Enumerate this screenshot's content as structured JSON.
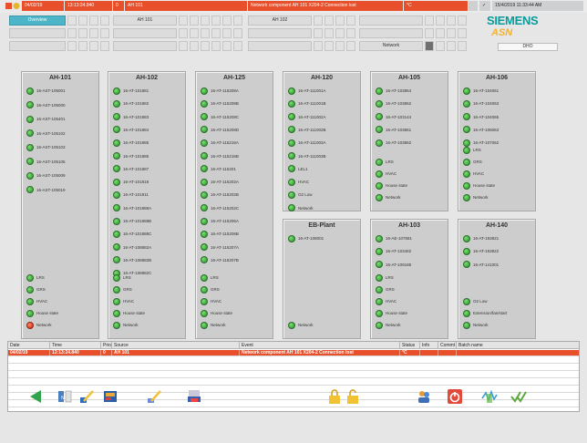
{
  "top_bar": {
    "date": "04/02/19",
    "time": "13:13:24.840",
    "flag": "0",
    "source": "AH 101",
    "message": "Network component AH 101 X204-2 Connection lost",
    "status": "°C",
    "clock": "15/4/2019 11:33:44 AM"
  },
  "nav": {
    "overview": "Overview",
    "ah101": "AH 101",
    "ah102": "AH 102",
    "network": "Network"
  },
  "brand": {
    "siemens": "SIEMENS",
    "asn": "ASN",
    "display": "DHO"
  },
  "panels": [
    {
      "title": "AH-101",
      "items": [
        {
          "label": "16-AST-105001",
          "status": "ok"
        },
        {
          "label": "16-AST-105000",
          "status": "ok"
        },
        {
          "label": "16-AST-105401",
          "status": "ok"
        },
        {
          "label": "16-AST-105102",
          "status": "ok"
        },
        {
          "label": "16-AST-105103",
          "status": "ok"
        },
        {
          "label": "16-AST-105105",
          "status": "ok"
        },
        {
          "label": "16-AST-105009",
          "status": "ok"
        },
        {
          "label": "16-AST-105019",
          "status": "ok"
        }
      ],
      "bottom": [
        {
          "label": "LRS",
          "status": "ok"
        },
        {
          "label": "GRS",
          "status": "ok"
        },
        {
          "label": "HVAC",
          "status": "ok"
        },
        {
          "label": "House state",
          "status": "ok"
        },
        {
          "label": "Network",
          "status": "alarm"
        }
      ]
    },
    {
      "title": "AH-102",
      "items": [
        {
          "label": "16-AT-101881",
          "status": "ok"
        },
        {
          "label": "16-AT-101882",
          "status": "ok"
        },
        {
          "label": "16-AT-101883",
          "status": "ok"
        },
        {
          "label": "16-AT-101884",
          "status": "ok"
        },
        {
          "label": "16-AT-101885",
          "status": "ok"
        },
        {
          "label": "16-AT-101886",
          "status": "ok"
        },
        {
          "label": "16-AT-101887",
          "status": "ok"
        },
        {
          "label": "16-AT-101818",
          "status": "ok"
        },
        {
          "label": "16-AT-101811",
          "status": "ok"
        },
        {
          "label": "16-AT-101888A",
          "status": "ok"
        },
        {
          "label": "16-AT-101888B",
          "status": "ok"
        },
        {
          "label": "16-AT-101888C",
          "status": "ok"
        },
        {
          "label": "16-AT-108882A",
          "status": "ok"
        },
        {
          "label": "16-AT-108882B",
          "status": "ok"
        },
        {
          "label": "16-AT-108882C",
          "status": "ok"
        }
      ],
      "bottom": [
        {
          "label": "LRS",
          "status": "ok"
        },
        {
          "label": "GRS",
          "status": "ok"
        },
        {
          "label": "HVAC",
          "status": "ok"
        },
        {
          "label": "House state",
          "status": "ok"
        },
        {
          "label": "Network",
          "status": "ok"
        }
      ]
    },
    {
      "title": "AH-125",
      "items": [
        {
          "label": "16-AT-115208A",
          "status": "ok"
        },
        {
          "label": "16-AT-115208B",
          "status": "ok"
        },
        {
          "label": "16-AT-115208C",
          "status": "ok"
        },
        {
          "label": "16-AT-115208D",
          "status": "ok"
        },
        {
          "label": "16-AT-115216A",
          "status": "ok"
        },
        {
          "label": "16-AT-115216B",
          "status": "ok"
        },
        {
          "label": "16-AT-115201",
          "status": "ok"
        },
        {
          "label": "16-AT-115202A",
          "status": "ok"
        },
        {
          "label": "16-AT-115202B",
          "status": "ok"
        },
        {
          "label": "16-AT-115202C",
          "status": "ok"
        },
        {
          "label": "16-AT-115206A",
          "status": "ok"
        },
        {
          "label": "16-AT-115206B",
          "status": "ok"
        },
        {
          "label": "16-AT-115207A",
          "status": "ok"
        },
        {
          "label": "16-AT-115207B",
          "status": "ok"
        }
      ],
      "bottom": [
        {
          "label": "LRS",
          "status": "ok"
        },
        {
          "label": "GRS",
          "status": "ok"
        },
        {
          "label": "HVAC",
          "status": "ok"
        },
        {
          "label": "House state",
          "status": "ok"
        },
        {
          "label": "Network",
          "status": "ok"
        }
      ]
    },
    {
      "title": "AH-120",
      "items": [
        {
          "label": "16-AT-111001A",
          "status": "ok"
        },
        {
          "label": "16-AT-111001B",
          "status": "ok"
        },
        {
          "label": "16-AT-111002A",
          "status": "ok"
        },
        {
          "label": "16-AT-111002B",
          "status": "ok"
        },
        {
          "label": "16-AT-111003A",
          "status": "ok"
        },
        {
          "label": "16-AT-111003B",
          "status": "ok"
        },
        {
          "label": "LEL1",
          "status": "ok"
        },
        {
          "label": "HVAC",
          "status": "ok"
        },
        {
          "label": "O2 Low",
          "status": "ok"
        },
        {
          "label": "Network",
          "status": "ok"
        }
      ],
      "bottom": []
    },
    {
      "title": "AH-105",
      "items": [
        {
          "label": "16-AT-103864",
          "status": "ok"
        },
        {
          "label": "16-AT-103862",
          "status": "ok"
        },
        {
          "label": "16-AT-103144",
          "status": "ok"
        },
        {
          "label": "16-AT-103861",
          "status": "ok"
        },
        {
          "label": "16-AT-103862",
          "status": "ok"
        }
      ],
      "bottom": [
        {
          "label": "LRS",
          "status": "ok"
        },
        {
          "label": "HVAC",
          "status": "ok"
        },
        {
          "label": "House state",
          "status": "ok"
        },
        {
          "label": "Network",
          "status": "ok"
        }
      ]
    },
    {
      "title": "AH-106",
      "items": [
        {
          "label": "16-AT-104061",
          "status": "ok"
        },
        {
          "label": "16-AT-104063",
          "status": "ok"
        },
        {
          "label": "16-AT-104065",
          "status": "ok"
        },
        {
          "label": "16-AT-106063",
          "status": "ok"
        },
        {
          "label": "16-AT-107062",
          "status": "ok"
        }
      ],
      "bottom": [
        {
          "label": "LRS",
          "status": "ok"
        },
        {
          "label": "GRS",
          "status": "ok"
        },
        {
          "label": "HVAC",
          "status": "ok"
        },
        {
          "label": "House state",
          "status": "ok"
        },
        {
          "label": "Network",
          "status": "ok"
        }
      ]
    },
    {
      "title": "EB-Plant",
      "items": [
        {
          "label": "16-AT-108001",
          "status": "ok"
        }
      ],
      "bottom": [
        {
          "label": "Network",
          "status": "ok"
        }
      ]
    },
    {
      "title": "AH-103",
      "items": [
        {
          "label": "16-AE-107681",
          "status": "ok"
        },
        {
          "label": "16-AT-103482",
          "status": "ok"
        },
        {
          "label": "16-AT-109188",
          "status": "ok"
        }
      ],
      "bottom": [
        {
          "label": "LRS",
          "status": "ok"
        },
        {
          "label": "GRS",
          "status": "ok"
        },
        {
          "label": "HVAC",
          "status": "ok"
        },
        {
          "label": "House state",
          "status": "ok"
        },
        {
          "label": "Network",
          "status": "ok"
        }
      ]
    },
    {
      "title": "AH-140",
      "items": [
        {
          "label": "16-AT-193821",
          "status": "ok"
        },
        {
          "label": "16-AT-193822",
          "status": "ok"
        },
        {
          "label": "16-AT-141001",
          "status": "ok"
        }
      ],
      "bottom": [
        {
          "label": "O2 Low",
          "status": "ok"
        },
        {
          "label": "Extension/fan/start",
          "status": "ok"
        },
        {
          "label": "Network",
          "status": "ok"
        }
      ]
    }
  ],
  "log": {
    "headers": [
      "Date",
      "Time",
      "Priori",
      "Source",
      "Event",
      "Status",
      "Info",
      "Commt",
      "Batch name"
    ],
    "rows": [
      [
        "04/02/19",
        "13:13:24.840",
        "0",
        "AH 101",
        "Network component AH 101 X204-2 Connection lost",
        "°C",
        "",
        "",
        ""
      ]
    ]
  },
  "colors": {
    "alarm": "#e7502b",
    "ok_led": "#3aa83a",
    "accent": "#4eb4c8",
    "brand": "#0a9b9b"
  },
  "toolbar": [
    "back-arrow-icon",
    "sort-icon",
    "edit-icon",
    "report-icon",
    "sign-icon",
    "print-icon",
    "lock-icon",
    "unlock-icon",
    "users-icon",
    "power-icon",
    "chart-icon",
    "acknowledge-icon"
  ]
}
